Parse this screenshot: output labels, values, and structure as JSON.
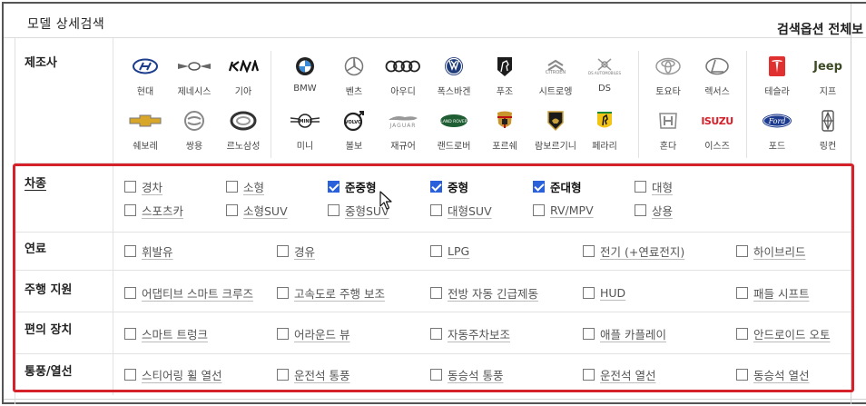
{
  "header": {
    "title": "모델 상세검색",
    "options_label": "검색옵션 전체보"
  },
  "manufacturer": {
    "label": "제조사",
    "brands": [
      {
        "name": "현대",
        "selected": true,
        "icon": "hyundai-logo-icon"
      },
      {
        "name": "제네시스",
        "selected": false,
        "icon": "genesis-logo-icon"
      },
      {
        "name": "기아",
        "selected": false,
        "icon": "kia-logo-icon"
      },
      {
        "name": "쉐보레",
        "selected": false,
        "icon": "chevrolet-logo-icon"
      },
      {
        "name": "쌍용",
        "selected": false,
        "icon": "ssangyong-logo-icon"
      },
      {
        "name": "르노삼성",
        "selected": false,
        "icon": "renault-logo-icon"
      },
      {
        "name": "BMW",
        "selected": false,
        "icon": "bmw-logo-icon"
      },
      {
        "name": "벤츠",
        "selected": false,
        "icon": "mercedes-logo-icon"
      },
      {
        "name": "아우디",
        "selected": false,
        "icon": "audi-logo-icon"
      },
      {
        "name": "폭스바겐",
        "selected": false,
        "icon": "volkswagen-logo-icon"
      },
      {
        "name": "푸조",
        "selected": false,
        "icon": "peugeot-logo-icon"
      },
      {
        "name": "시트로엥",
        "selected": false,
        "icon": "citroen-logo-icon",
        "logo_text": "CITROEN"
      },
      {
        "name": "DS",
        "selected": false,
        "icon": "ds-logo-icon",
        "logo_text": "DS AUTOMOBILES"
      },
      {
        "name": "미니",
        "selected": false,
        "icon": "mini-logo-icon",
        "logo_text": "MINI"
      },
      {
        "name": "볼보",
        "selected": false,
        "icon": "volvo-logo-icon",
        "logo_text": "VOLVO"
      },
      {
        "name": "재규어",
        "selected": false,
        "icon": "jaguar-logo-icon",
        "logo_text": "JAGUAR"
      },
      {
        "name": "랜드로버",
        "selected": false,
        "icon": "landrover-logo-icon",
        "logo_text": "LAND ROVER"
      },
      {
        "name": "포르쉐",
        "selected": false,
        "icon": "porsche-logo-icon"
      },
      {
        "name": "람보르기니",
        "selected": false,
        "icon": "lamborghini-logo-icon"
      },
      {
        "name": "페라리",
        "selected": false,
        "icon": "ferrari-logo-icon"
      },
      {
        "name": "토요타",
        "selected": false,
        "icon": "toyota-logo-icon"
      },
      {
        "name": "렉서스",
        "selected": false,
        "icon": "lexus-logo-icon"
      },
      {
        "name": "혼다",
        "selected": false,
        "icon": "honda-logo-icon"
      },
      {
        "name": "이스즈",
        "selected": false,
        "icon": "isuzu-logo-icon",
        "logo_text": "ISUZU"
      },
      {
        "name": "테슬라",
        "selected": false,
        "icon": "tesla-logo-icon"
      },
      {
        "name": "지프",
        "selected": false,
        "icon": "jeep-logo-icon",
        "logo_text": "Jeep"
      },
      {
        "name": "포드",
        "selected": false,
        "icon": "ford-logo-icon",
        "logo_text": "Ford"
      },
      {
        "name": "링컨",
        "selected": false,
        "icon": "lincoln-logo-icon"
      }
    ]
  },
  "vehicle_type": {
    "label": "차종",
    "options": [
      {
        "label": "경차",
        "checked": false
      },
      {
        "label": "소형",
        "checked": false
      },
      {
        "label": "준중형",
        "checked": true
      },
      {
        "label": "중형",
        "checked": true
      },
      {
        "label": "준대형",
        "checked": true
      },
      {
        "label": "대형",
        "checked": false
      },
      {
        "label": "스포츠카",
        "checked": false
      },
      {
        "label": "소형SUV",
        "checked": false
      },
      {
        "label": "중형SUV",
        "checked": false
      },
      {
        "label": "대형SUV",
        "checked": false
      },
      {
        "label": "RV/MPV",
        "checked": false
      },
      {
        "label": "상용",
        "checked": false
      }
    ]
  },
  "fuel": {
    "label": "연료",
    "options": [
      {
        "label": "휘발유",
        "checked": false
      },
      {
        "label": "경유",
        "checked": false
      },
      {
        "label": "LPG",
        "checked": false
      },
      {
        "label": "전기 (+연료전지)",
        "checked": false
      },
      {
        "label": "하이브리드",
        "checked": false
      }
    ]
  },
  "driving_assist": {
    "label": "주행 지원",
    "options": [
      {
        "label": "어댑티브 스마트 크루즈",
        "checked": false
      },
      {
        "label": "고속도로 주행 보조",
        "checked": false
      },
      {
        "label": "전방 자동 긴급제동",
        "checked": false
      },
      {
        "label": "HUD",
        "checked": false
      },
      {
        "label": "패들 시프트",
        "checked": false
      }
    ]
  },
  "convenience": {
    "label": "편의 장치",
    "options": [
      {
        "label": "스마트 트렁크",
        "checked": false
      },
      {
        "label": "어라운드 뷰",
        "checked": false
      },
      {
        "label": "자동주차보조",
        "checked": false
      },
      {
        "label": "애플 카플레이",
        "checked": false
      },
      {
        "label": "안드로이드 오토",
        "checked": false
      }
    ]
  },
  "ventilation": {
    "label": "통풍/열선",
    "options": [
      {
        "label": "스티어링 휠 열선",
        "checked": false
      },
      {
        "label": "운전석 통풍",
        "checked": false
      },
      {
        "label": "동승석 통풍",
        "checked": false
      },
      {
        "label": "운전석 열선",
        "checked": false
      },
      {
        "label": "동승석 열선",
        "checked": false
      }
    ]
  },
  "colors": {
    "highlight": "#d6202a",
    "checked": "#2a60d9",
    "selected_border": "#2a57c8"
  }
}
